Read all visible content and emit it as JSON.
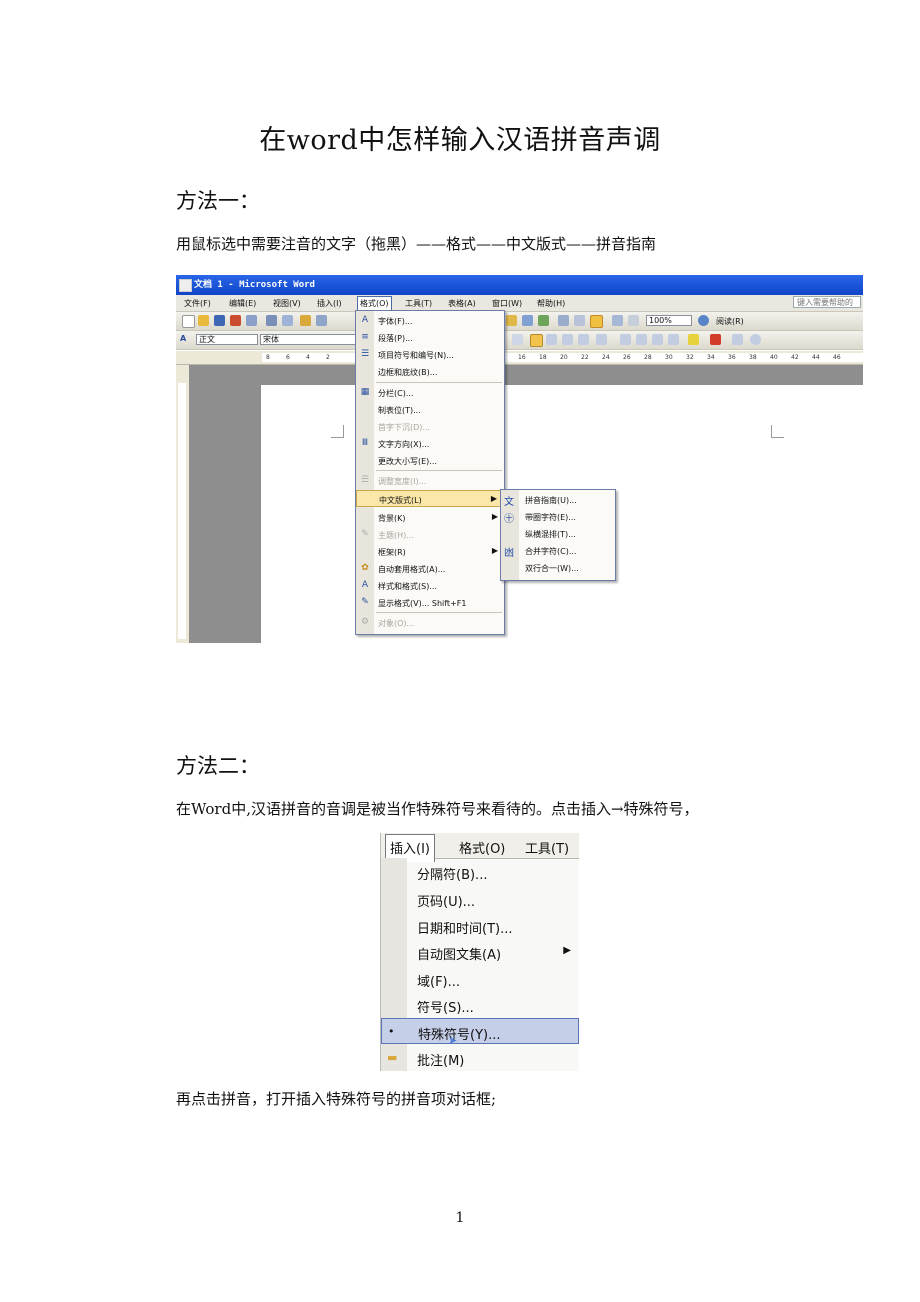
{
  "title": "在word中怎样输入汉语拼音声调",
  "method1": {
    "heading": "方法一：",
    "text": "用鼠标选中需要注音的文字（拖黑）——格式——中文版式——拼音指南"
  },
  "shot1": {
    "window_title": "文档 1 - Microsoft Word",
    "menubar": [
      "文件(F)",
      "编辑(E)",
      "视图(V)",
      "插入(I)",
      "格式(O)",
      "工具(T)",
      "表格(A)",
      "窗口(W)",
      "帮助(H)"
    ],
    "help_placeholder": "键入需要帮助的",
    "style_value": "正文",
    "font_value": "宋体",
    "zoom_value": "100%",
    "read_label": "阅读(R)",
    "ruler_left": [
      "8",
      "6",
      "4",
      "2"
    ],
    "ruler_right": [
      "16",
      "18",
      "20",
      "22",
      "24",
      "26",
      "28",
      "30",
      "32",
      "34",
      "36",
      "38",
      "40",
      "42",
      "44",
      "46"
    ],
    "format_menu": [
      {
        "label": "字体(F)...",
        "icon": "A"
      },
      {
        "label": "段落(P)...",
        "icon": "≡"
      },
      {
        "label": "项目符号和编号(N)...",
        "icon": "☰"
      },
      {
        "label": "边框和底纹(B)...",
        "icon": ""
      },
      {
        "label": "分栏(C)...",
        "icon": "▦"
      },
      {
        "label": "制表位(T)...",
        "icon": ""
      },
      {
        "label": "首字下沉(D)...",
        "icon": ""
      },
      {
        "label": "文字方向(X)...",
        "icon": "Ⅲ"
      },
      {
        "label": "更改大小写(E)...",
        "icon": ""
      },
      {
        "label": "调整宽度(I)...",
        "icon": "☰"
      },
      {
        "label": "中文版式(L)",
        "icon": ""
      },
      {
        "label": "背景(K)",
        "icon": ""
      },
      {
        "label": "主题(H)...",
        "icon": "✎"
      },
      {
        "label": "框架(R)",
        "icon": ""
      },
      {
        "label": "自动套用格式(A)...",
        "icon": "✿"
      },
      {
        "label": "样式和格式(S)...",
        "icon": "A"
      },
      {
        "label": "显示格式(V)...  Shift+F1",
        "icon": "✎"
      },
      {
        "label": "对象(O)...",
        "icon": "⚙"
      }
    ],
    "submenu": [
      {
        "label": "拼音指南(U)...",
        "icon": "文"
      },
      {
        "label": "带圈字符(E)...",
        "icon": "㊉"
      },
      {
        "label": "纵横混排(T)...",
        "icon": ""
      },
      {
        "label": "合并字符(C)...",
        "icon": "凼"
      },
      {
        "label": "双行合一(W)...",
        "icon": ""
      }
    ]
  },
  "method2": {
    "heading": "方法二：",
    "text": "在Word中,汉语拼音的音调是被当作特殊符号来看待的。点击插入→特殊符号，",
    "after": "再点击拼音，打开插入特殊符号的拼音项对话框;"
  },
  "shot2": {
    "menubar": [
      "插入(I)",
      "格式(O)",
      "工具(T)"
    ],
    "items": [
      {
        "label": "分隔符(B)..."
      },
      {
        "label": "页码(U)..."
      },
      {
        "label": "日期和时间(T)..."
      },
      {
        "label": "自动图文集(A)"
      },
      {
        "label": "域(F)..."
      },
      {
        "label": "符号(S)..."
      },
      {
        "label": "特殊符号(Y)..."
      },
      {
        "label": "批注(M)"
      }
    ]
  },
  "page_number": "1"
}
